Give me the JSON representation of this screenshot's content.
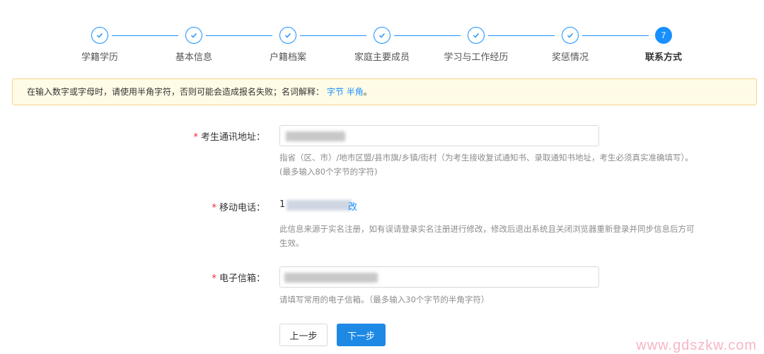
{
  "steps": [
    {
      "label": "学籍学历",
      "state": "done"
    },
    {
      "label": "基本信息",
      "state": "done"
    },
    {
      "label": "户籍档案",
      "state": "done"
    },
    {
      "label": "家庭主要成员",
      "state": "done"
    },
    {
      "label": "学习与工作经历",
      "state": "done"
    },
    {
      "label": "奖惩情况",
      "state": "done"
    },
    {
      "label": "联系方式",
      "state": "current",
      "number": "7"
    }
  ],
  "notice": {
    "text": "在输入数字或字母时，请使用半角字符，否则可能会造成报名失败；名词解释：",
    "link_byte": "字节",
    "link_half": "半角",
    "end": "。"
  },
  "form": {
    "address": {
      "label": "考生通讯地址：",
      "help_line1": "指省（区、市）/地市区盟/县市旗/乡镇/街村（为考生接收复试通知书、录取通知书地址，考生必须真实准确填写）。",
      "help_line2": "(最多输入80个字节的字符)"
    },
    "mobile": {
      "label": "移动电话：",
      "value_prefix": "1",
      "value_suffix": "改",
      "help_line1": "此信息来源于实名注册，如有误请登录实名注册进行修改，修改后退出系统且关闭浏览器重新登录并同步信息后方可",
      "help_line2": "生效。"
    },
    "email": {
      "label": "电子信箱：",
      "help": "请填写常用的电子信箱。（最多输入30个字节的半角字符）"
    },
    "required_mark": "*"
  },
  "buttons": {
    "prev": "上一步",
    "next": "下一步"
  },
  "watermark": "www.gdszkw.com",
  "colors": {
    "accent": "#1890ff",
    "notice_bg": "#fffbe6",
    "required": "#f5222d"
  }
}
